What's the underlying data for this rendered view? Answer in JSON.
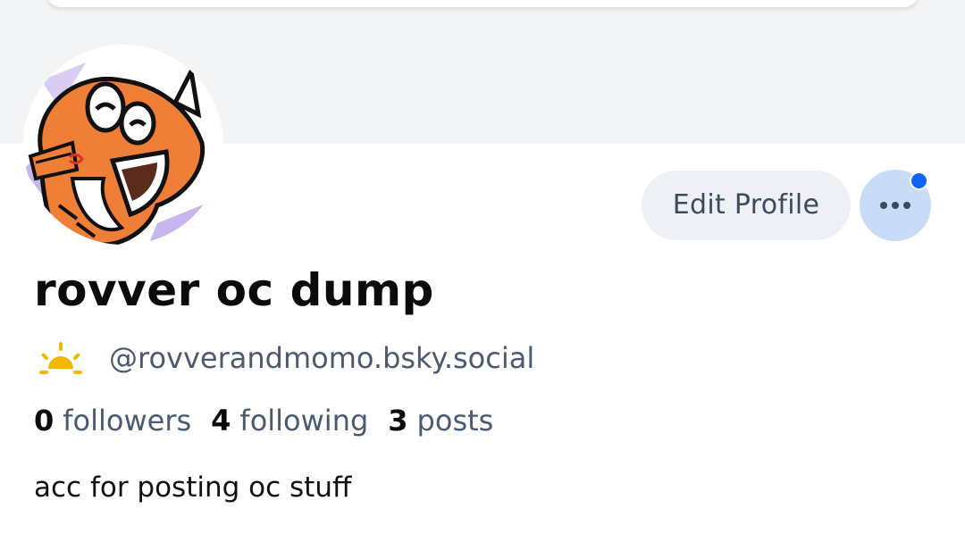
{
  "profile": {
    "display_name": "rovver oc dump",
    "handle": "@rovverandmomo.bsky.social",
    "handle_icon": "sunrise-icon",
    "bio": "acc for posting oc stuff",
    "stats": {
      "followers_count": "0",
      "followers_label": "followers",
      "following_count": "4",
      "following_label": "following",
      "posts_count": "3",
      "posts_label": "posts"
    }
  },
  "actions": {
    "edit_profile_label": "Edit Profile",
    "more_icon": "more-horizontal-icon"
  },
  "colors": {
    "banner": "#f3f4f6",
    "edit_button_bg": "#edf0f4",
    "more_button_bg": "#c9dcf7",
    "notification_dot": "#1264f7",
    "secondary_text": "#4b5a6e",
    "sun_icon": "#f2b705"
  }
}
